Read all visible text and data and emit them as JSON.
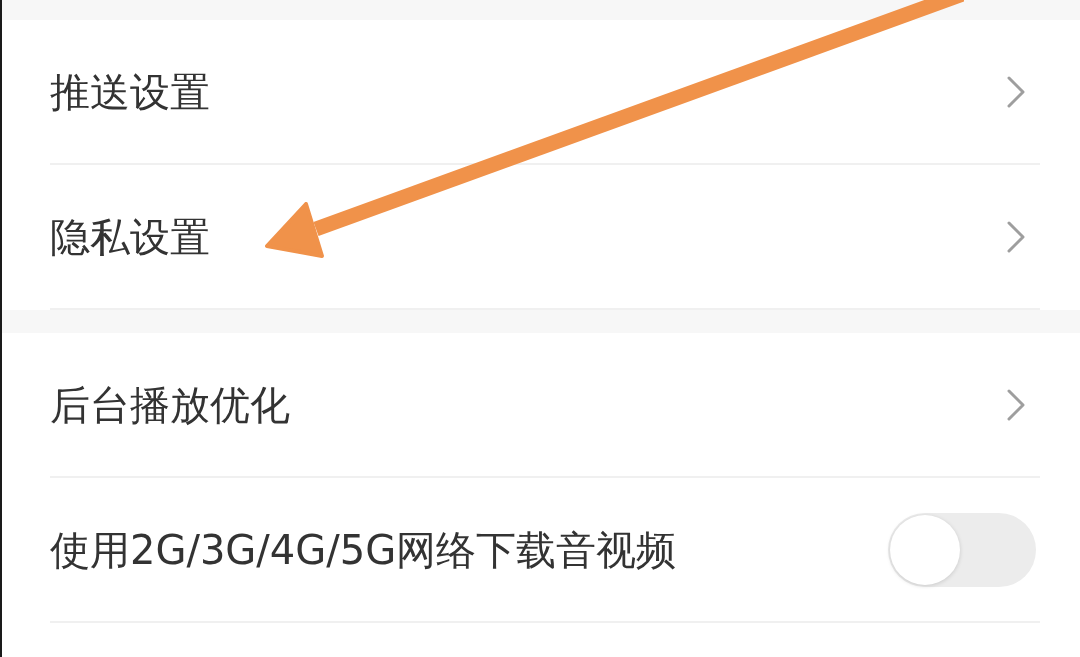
{
  "sections": [
    {
      "items": [
        {
          "kind": "link",
          "label": "推送设置",
          "marked": false
        },
        {
          "kind": "link",
          "label": "隐私设置",
          "marked": true
        }
      ]
    },
    {
      "items": [
        {
          "kind": "link",
          "label": "后台播放优化",
          "marked": false
        },
        {
          "kind": "toggle",
          "label": "使用2G/3G/4G/5G网络下载音视频",
          "on": false,
          "marked": false
        }
      ]
    }
  ]
}
